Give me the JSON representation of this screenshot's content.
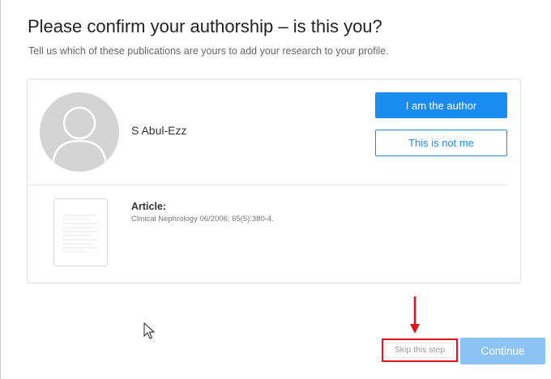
{
  "dialog": {
    "title": "Please confirm your authorship – is this you?",
    "subtitle": "Tell us which of these publications are yours to add your research to your profile."
  },
  "author": {
    "name": "S Abul-Ezz",
    "avatar_icon": "person-silhouette-icon"
  },
  "actions": {
    "confirm_label": "I am the author",
    "reject_label": "This is not me"
  },
  "publication": {
    "type_label": "Article:",
    "citation": "Clinical Nephrology 06/2006; 65(5):380-4.",
    "thumbnail_icon": "document-thumbnail-icon"
  },
  "footer": {
    "skip_label": "Skip this step",
    "continue_label": "Continue"
  },
  "colors": {
    "primary": "#1a8cf0",
    "continue_disabled": "#8cc4f6",
    "highlight": "#e0141e",
    "avatar_bg": "#d4d4d4"
  },
  "annotation": {
    "arrow_icon": "red-down-arrow-icon",
    "highlight_box": "red-rectangle"
  }
}
